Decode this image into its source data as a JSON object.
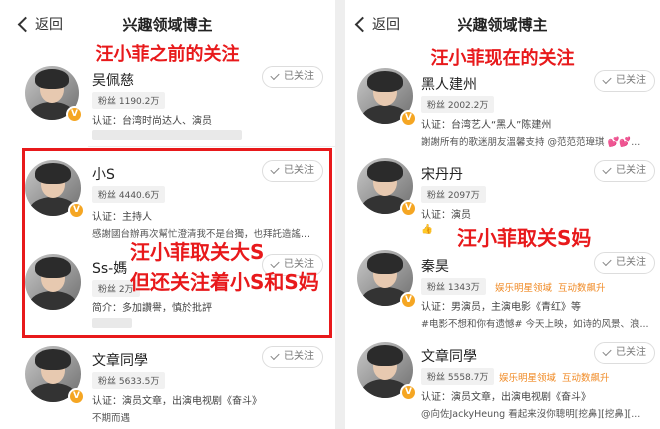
{
  "left": {
    "back_label": "返回",
    "page_title": "兴趣领域博主",
    "section_label": "汪小菲之前的关注",
    "overlay_line1": "汪小菲取关大S",
    "overlay_line2": "但还关注着小S和S妈",
    "users": [
      {
        "name": "吴佩慈",
        "fans": "粉丝 1190.2万",
        "meta": "认证：台湾时尚达人、演员",
        "desc": "",
        "follow": "已关注"
      },
      {
        "name": "小S",
        "fans": "粉丝 4440.6万",
        "meta": "认证：主持人",
        "desc": "感謝國台辦再次幫忙澄清我不是台獨，也拜託造謠...",
        "follow": "已关注"
      },
      {
        "name": "Ss-媽",
        "fans": "粉丝 2万",
        "meta": "简介：多加讚譽，慎於批評",
        "desc": "",
        "follow": "已关注"
      },
      {
        "name": "文章同學",
        "fans": "粉丝 5633.5万",
        "meta": "认证：演员文章，出演电视剧《奋斗》",
        "desc": "不期而遇",
        "follow": "已关注"
      }
    ]
  },
  "right": {
    "back_label": "返回",
    "page_title": "兴趣领域博主",
    "section_label": "汪小菲现在的关注",
    "overlay": "汪小菲取关S妈",
    "users": [
      {
        "name": "黑人建州",
        "fans": "粉丝 2002.2万",
        "tags": [],
        "meta": "认证：台湾艺人“黑人”陈建州",
        "desc": "謝謝所有的歌迷朋友溫馨支持 @范范范瑋琪 💕💕...",
        "follow": "已关注"
      },
      {
        "name": "宋丹丹",
        "fans": "粉丝 2097万",
        "tags": [],
        "meta": "认证：演员",
        "desc": "👍",
        "follow": "已关注"
      },
      {
        "name": "秦昊",
        "fans": "粉丝 1343万",
        "tags": [
          "娱乐明星领域",
          "互动数飙升"
        ],
        "meta": "认证：男演员，主演电影《青红》等",
        "desc": "#电影不想和你有遗憾# 今天上映，如诗的风景、浪...",
        "follow": "已关注"
      },
      {
        "name": "文章同學",
        "fans": "粉丝 5558.7万",
        "tags": [
          "娱乐明星领域",
          "互动数飙升"
        ],
        "meta": "认证：演员文章，出演电视剧《奋斗》",
        "desc": "@向佐JackyHeung 看起来沒你聰明[挖鼻][挖鼻][...",
        "follow": "已关注"
      }
    ]
  },
  "colors": {
    "highlight": "#e8191b",
    "tag": "#f08a24",
    "badge": "#f5a623"
  }
}
